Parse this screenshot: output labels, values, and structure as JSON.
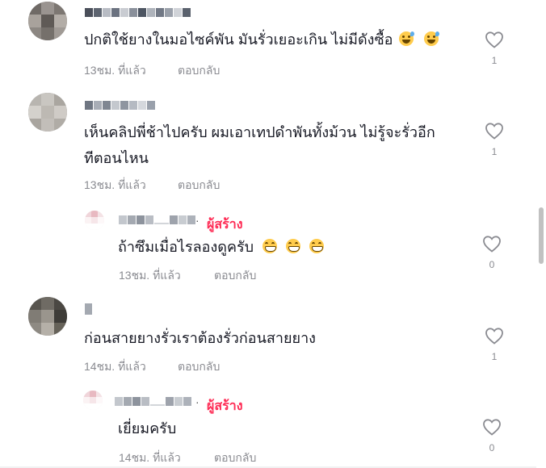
{
  "comments": [
    {
      "text": "ปกติใช้ยางในมอไซค์พัน มันรั่วเยอะเกิน ไม่มีดังซื้อ",
      "emoji": [
        "😅",
        "😅"
      ],
      "time": "13ชม. ที่แล้ว",
      "reply": "ตอบกลับ",
      "likes": "1"
    },
    {
      "text_line1": "เห็นคลิปพี่ช้าไปครับ ผมเอาเทปดำพันทั้งม้วน ไม่รู้จะรั่วอีก",
      "text_line2": "ทีตอนไหน",
      "time": "13ชม. ที่แล้ว",
      "reply": "ตอบกลับ",
      "likes": "1"
    },
    {
      "creator_label": "ผู้สร้าง",
      "separator": "·",
      "text": "ถ้าซึมเมื่อไรลองดูครับ",
      "emoji": [
        "😁",
        "😁",
        "😁"
      ],
      "time": "13ชม. ที่แล้ว",
      "reply": "ตอบกลับ",
      "likes": "0"
    },
    {
      "text": "ก่อนสายยางรั่วเราต้องรั่วก่อนสายยาง",
      "time": "14ชม. ที่แล้ว",
      "reply": "ตอบกลับ",
      "likes": "1"
    },
    {
      "creator_label": "ผู้สร้าง",
      "separator": "·",
      "text": "เยี่ยมครับ",
      "time": "14ชม. ที่แล้ว",
      "reply": "ตอบกลับ",
      "likes": "0"
    }
  ],
  "icons": {
    "like": "heart-outline-icon"
  },
  "colors": {
    "creator": "#fe2c55",
    "meta": "#8a8b91",
    "text": "#161823"
  }
}
